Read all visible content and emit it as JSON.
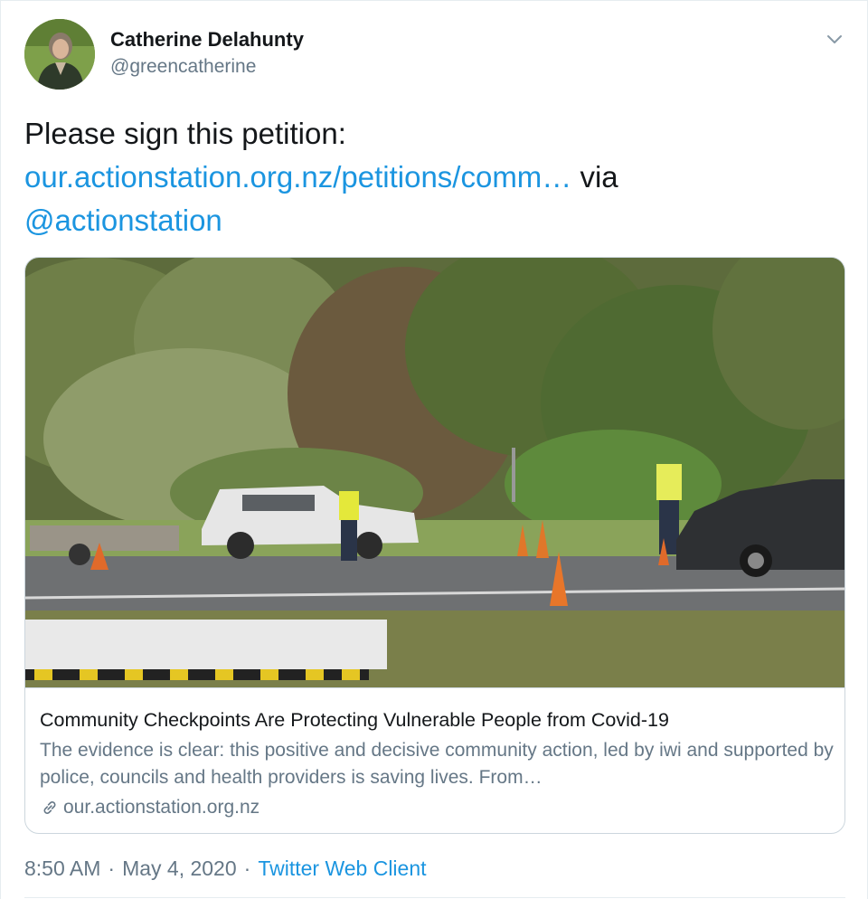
{
  "author": {
    "name": "Catherine Delahunty",
    "handle": "@greencatherine"
  },
  "tweet": {
    "text_prefix": "Please sign this petition:",
    "link_text": "our.actionstation.org.nz/petitions/comm…",
    "via_text": "via",
    "mention": "@actionstation"
  },
  "card": {
    "title": "Community Checkpoints Are Protecting Vulnerable People from Covid-19",
    "description": "The evidence is clear: this positive and decisive community action, led by iwi and supported by police, councils and health providers is saving lives. From…",
    "domain": "our.actionstation.org.nz"
  },
  "meta": {
    "time": "8:50 AM",
    "date": "May 4, 2020",
    "separator": "·",
    "source": "Twitter Web Client"
  },
  "icons": {
    "caret": "chevron-down-icon",
    "link": "link-icon"
  },
  "colors": {
    "link": "#1b95e0",
    "secondary_text": "#657786",
    "border": "#ccd6dd"
  }
}
